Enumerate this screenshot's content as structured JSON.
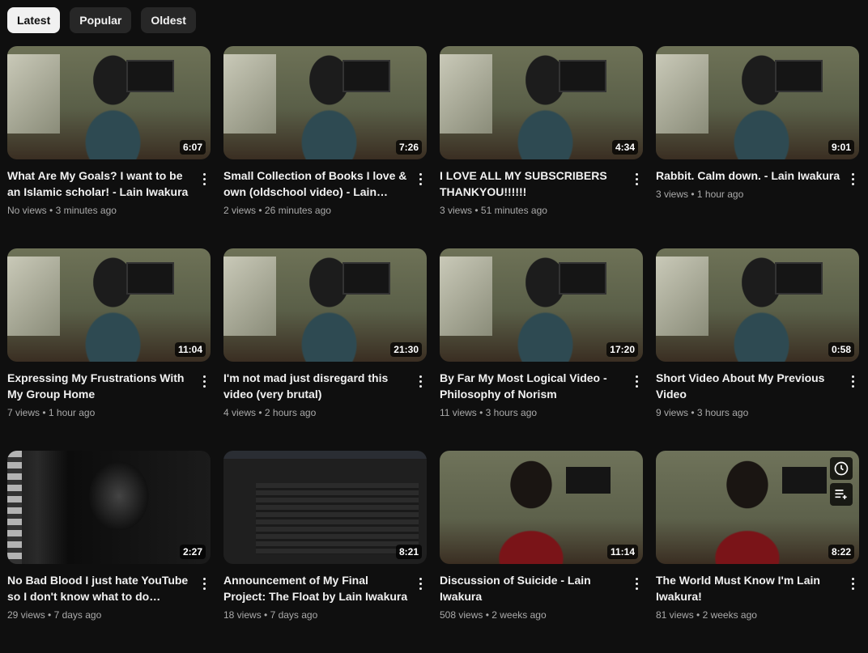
{
  "filters": [
    {
      "label": "Latest",
      "active": true
    },
    {
      "label": "Popular",
      "active": false
    },
    {
      "label": "Oldest",
      "active": false
    }
  ],
  "videos": [
    {
      "title": "What Are My Goals? I want to be an Islamic scholar! - Lain Iwakura",
      "views": "No views",
      "age": "3 minutes ago",
      "duration": "6:07",
      "thumb": "room"
    },
    {
      "title": "Small Collection of Books I love & own (oldschool video) - Lain…",
      "views": "2 views",
      "age": "26 minutes ago",
      "duration": "7:26",
      "thumb": "room"
    },
    {
      "title": "I LOVE ALL MY SUBSCRIBERS THANKYOU!!!!!!",
      "views": "3 views",
      "age": "51 minutes ago",
      "duration": "4:34",
      "thumb": "room"
    },
    {
      "title": "Rabbit. Calm down. - Lain Iwakura",
      "views": "3 views",
      "age": "1 hour ago",
      "duration": "9:01",
      "thumb": "room"
    },
    {
      "title": "Expressing My Frustrations With My Group Home",
      "views": "7 views",
      "age": "1 hour ago",
      "duration": "11:04",
      "thumb": "room"
    },
    {
      "title": "I'm not mad just disregard this video (very brutal)",
      "views": "4 views",
      "age": "2 hours ago",
      "duration": "21:30",
      "thumb": "room"
    },
    {
      "title": "By Far My Most Logical Video - Philosophy of Norism",
      "views": "11 views",
      "age": "3 hours ago",
      "duration": "17:20",
      "thumb": "room"
    },
    {
      "title": "Short Video About My Previous Video",
      "views": "9 views",
      "age": "3 hours ago",
      "duration": "0:58",
      "thumb": "room"
    },
    {
      "title": "No Bad Blood I just hate YouTube so I don't know what to do anymore",
      "views": "29 views",
      "age": "7 days ago",
      "duration": "2:27",
      "thumb": "art"
    },
    {
      "title": "Announcement of My Final Project: The Float by Lain Iwakura",
      "views": "18 views",
      "age": "7 days ago",
      "duration": "8:21",
      "thumb": "screen"
    },
    {
      "title": "Discussion of Suicide - Lain Iwakura",
      "views": "508 views",
      "age": "2 weeks ago",
      "duration": "11:14",
      "thumb": "hoodie"
    },
    {
      "title": "The World Must Know I'm Lain Iwakura!",
      "views": "81 views",
      "age": "2 weeks ago",
      "duration": "8:22",
      "thumb": "hoodie",
      "hovered": true
    }
  ],
  "icons": {
    "watch_later": "clock-icon",
    "add_to_queue": "queue-icon",
    "more": "more-vert-icon"
  }
}
